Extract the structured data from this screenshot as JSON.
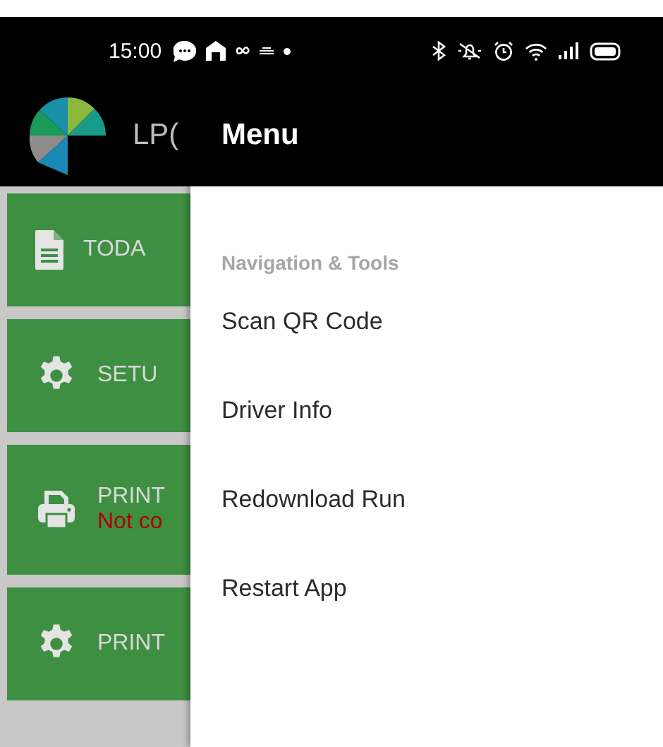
{
  "status_bar": {
    "time": "15:00"
  },
  "app_bar": {
    "title": "LP("
  },
  "cards": [
    {
      "kind": "document",
      "label": "TODA"
    },
    {
      "kind": "settings",
      "label": "SETU"
    },
    {
      "kind": "printer",
      "label": "PRINT",
      "status": "Not co"
    },
    {
      "kind": "settings",
      "label": "PRINT"
    }
  ],
  "drawer": {
    "title": "Menu",
    "section": "Navigation & Tools",
    "items": [
      "Scan QR Code",
      "Driver Info",
      "Redownload Run",
      "Restart App"
    ]
  }
}
